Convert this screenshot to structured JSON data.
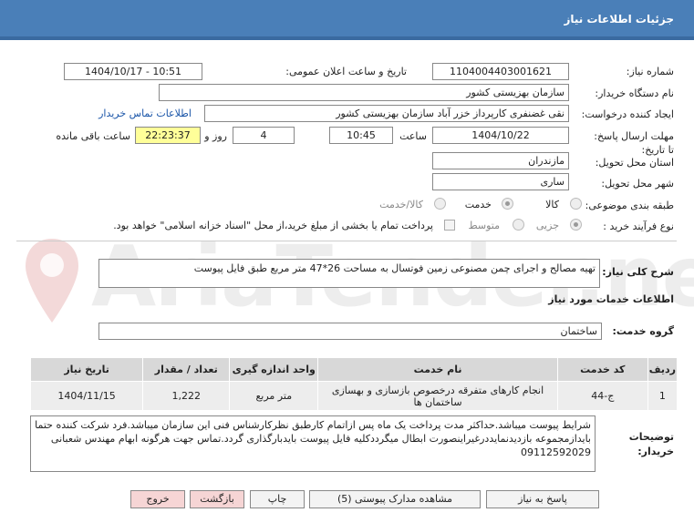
{
  "header": {
    "title": "جزئیات اطلاعات نیاز"
  },
  "form": {
    "need_number_label": "شماره نیاز:",
    "need_number": "1104004403001621",
    "announce_label": "تاریخ و ساعت اعلان عمومی:",
    "announce_value": "1404/10/17 - 10:51",
    "buyer_org_label": "نام دستگاه خریدار:",
    "buyer_org": "سازمان بهزیستی کشور",
    "creator_label": "ایجاد کننده درخواست:",
    "creator": "نقی غضنفری کارپرداز خزر آباد سازمان بهزیستی کشور",
    "contact_link": "اطلاعات تماس خریدار",
    "deadline_label": "مهلت ارسال پاسخ: تا تاریخ:",
    "deadline_date": "1404/10/22",
    "time_label": "ساعت",
    "deadline_time": "10:45",
    "days_value": "4",
    "days_label": "روز و",
    "remaining_time": "22:23:37",
    "remaining_label": "ساعت باقی مانده",
    "province_label": "استان محل تحویل:",
    "province": "مازندران",
    "city_label": "شهر محل تحویل:",
    "city": "ساری",
    "category_label": "طبقه بندی موضوعی:",
    "category_options": [
      "کالا",
      "خدمت",
      "کالا/خدمت"
    ],
    "category_selected": "خدمت",
    "process_label": "نوع فرآیند خرید :",
    "process_options": [
      "جزیی",
      "متوسط"
    ],
    "process_selected": "جزیی",
    "payment_note": "پرداخت تمام یا بخشی از مبلغ خرید،از محل \"اسناد خزانه اسلامی\" خواهد بود."
  },
  "description": {
    "label": "شرح کلی نیاز:",
    "text": "تهیه مصالح و اجرای چمن مصنوعی زمین فوتسال به مساحت 26*47 متر مربع  طبق فایل پیوست"
  },
  "services": {
    "section_title": "اطلاعات خدمات مورد نیاز",
    "group_label": "گروه خدمت:",
    "group_value": "ساختمان",
    "columns": [
      "ردیف",
      "کد خدمت",
      "نام خدمت",
      "واحد اندازه گیری",
      "تعداد / مقدار",
      "تاریخ نیاز"
    ],
    "rows": [
      [
        "1",
        "ج-44",
        "انجام کارهای متفرقه درخصوص بازسازی و بهسازی ساختمان ها",
        "متر مربع",
        "1,222",
        "1404/11/15"
      ]
    ]
  },
  "buyer_notes": {
    "label": "توضیحات خریدار:",
    "text": "شرایط پیوست میباشد.حداکثر مدت پرداخت یک ماه پس ازاتمام کارطبق نظرکارشناس فنی این سازمان میباشد.فرد شرکت کننده حتما بایدازمجموعه بازدیدنمایددرغیراینصورت ابطال میگرددکلیه فایل پیوست بایدبارگذاری گردد.تماس جهت هرگونه ابهام مهندس شعبانی 09112592029"
  },
  "buttons": {
    "reply": "پاسخ به نیاز",
    "view_docs": "مشاهده مدارک پیوستی (5)",
    "print": "چاپ",
    "back": "بازگشت",
    "exit": "خروج"
  },
  "watermark": {
    "text": "AriaTender.net"
  },
  "colors": {
    "header": "#4a7fb8",
    "highlight": "#ffff99",
    "link": "#1a55a8"
  }
}
